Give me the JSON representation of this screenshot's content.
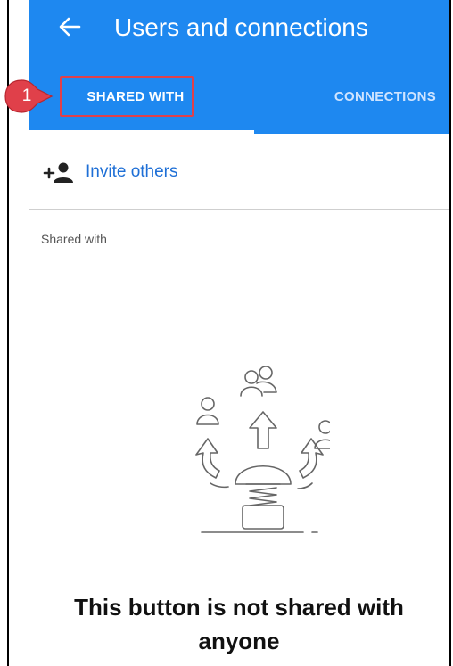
{
  "header": {
    "title": "Users and connections",
    "back_icon": "back-arrow-icon"
  },
  "tabs": [
    {
      "label": "SHARED WITH",
      "selected": true
    },
    {
      "label": "CONNECTIONS",
      "selected": false
    }
  ],
  "annotation": {
    "number": "1"
  },
  "invite": {
    "label": "Invite others",
    "icon": "add-person-icon"
  },
  "section": {
    "label": "Shared with"
  },
  "empty_state": {
    "line1": "This button is not shared with",
    "line2": "anyone"
  },
  "colors": {
    "appbar": "#1e88f0",
    "accent": "#1e6fd6",
    "callout": "#e0404a"
  }
}
